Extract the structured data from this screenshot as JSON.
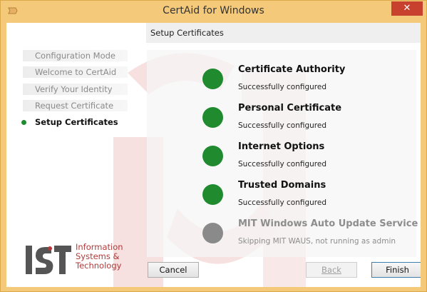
{
  "window": {
    "title": "CertAid for Windows",
    "close_glyph": "✕"
  },
  "header": {
    "label": "Setup Certificates"
  },
  "steps": [
    {
      "label": "Configuration Mode",
      "active": false
    },
    {
      "label": "Welcome to CertAid",
      "active": false
    },
    {
      "label": "Verify Your Identity",
      "active": false
    },
    {
      "label": "Request Certificate",
      "active": false
    },
    {
      "label": "Setup Certificates",
      "active": true
    }
  ],
  "items": [
    {
      "title": "Certificate Authority",
      "status": "Successfully configured",
      "state": "success"
    },
    {
      "title": "Personal Certificate",
      "status": "Successfully configured",
      "state": "success"
    },
    {
      "title": "Internet Options",
      "status": "Successfully configured",
      "state": "success"
    },
    {
      "title": "Trusted Domains",
      "status": "Successfully configured",
      "state": "success"
    },
    {
      "title": "MIT Windows Auto Update Service",
      "status": "Skipping MIT WAUS, not running as admin",
      "state": "skipped"
    }
  ],
  "logo": {
    "line1": "Information",
    "line2": "Systems &",
    "line3": "Technology"
  },
  "buttons": {
    "cancel": "Cancel",
    "back": "Back",
    "finish": "Finish"
  },
  "colors": {
    "success": "#1f8a2e",
    "skipped": "#8a8a8a",
    "titlebar": "#f4c97a",
    "close": "#c7412e",
    "brand": "#b23a3a"
  }
}
